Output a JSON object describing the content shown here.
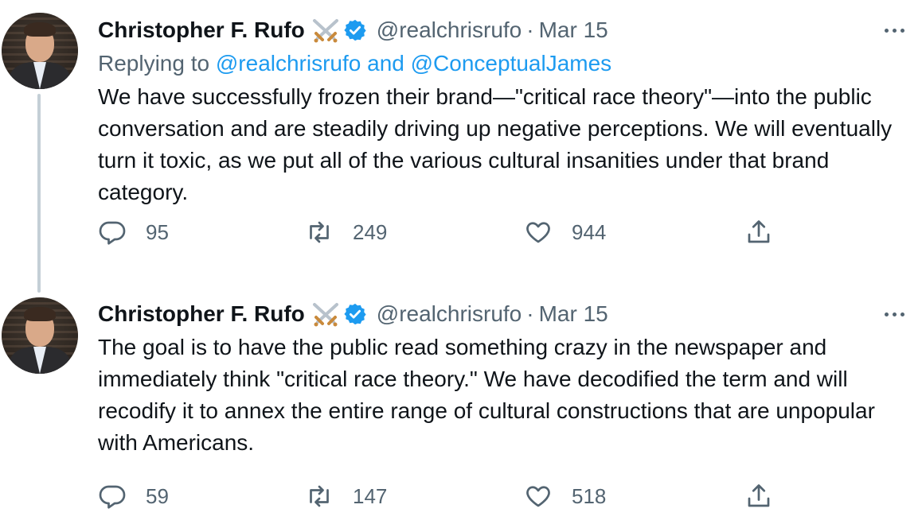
{
  "tweets": [
    {
      "name": "Christopher F. Rufo",
      "handle": "@realchrisrufo",
      "separator": "·",
      "date": "Mar 15",
      "replying_prefix": "Replying to",
      "replying_mentions": "@realchrisrufo and @ConceptualJames",
      "text": "We have successfully frozen their brand—\"critical race theory\"—into the public conversation and are steadily driving up negative perceptions. We will eventually turn it toxic, as we put all of the various cultural insanities under that brand category.",
      "replies": "95",
      "retweets": "249",
      "likes": "944"
    },
    {
      "name": "Christopher F. Rufo",
      "handle": "@realchrisrufo",
      "separator": "·",
      "date": "Mar 15",
      "text": "The goal is to have the public read something crazy in the newspaper and immediately think \"critical race theory.\" We have decodified the term and will recodify it to annex the entire range of cultural constructions that are unpopular with Americans.",
      "replies": "59",
      "retweets": "147",
      "likes": "518"
    }
  ],
  "icons": {
    "name_emoji": "crossed-swords-icon",
    "verified": "verified-badge-icon",
    "more": "more-icon",
    "reply": "reply-icon",
    "retweet": "retweet-icon",
    "like": "like-icon",
    "share": "share-icon"
  },
  "colors": {
    "text": "#0f1419",
    "secondary": "#536471",
    "link": "#1d9bf0",
    "verified": "#1d9bf0",
    "thread_line": "#c4cfd6"
  }
}
